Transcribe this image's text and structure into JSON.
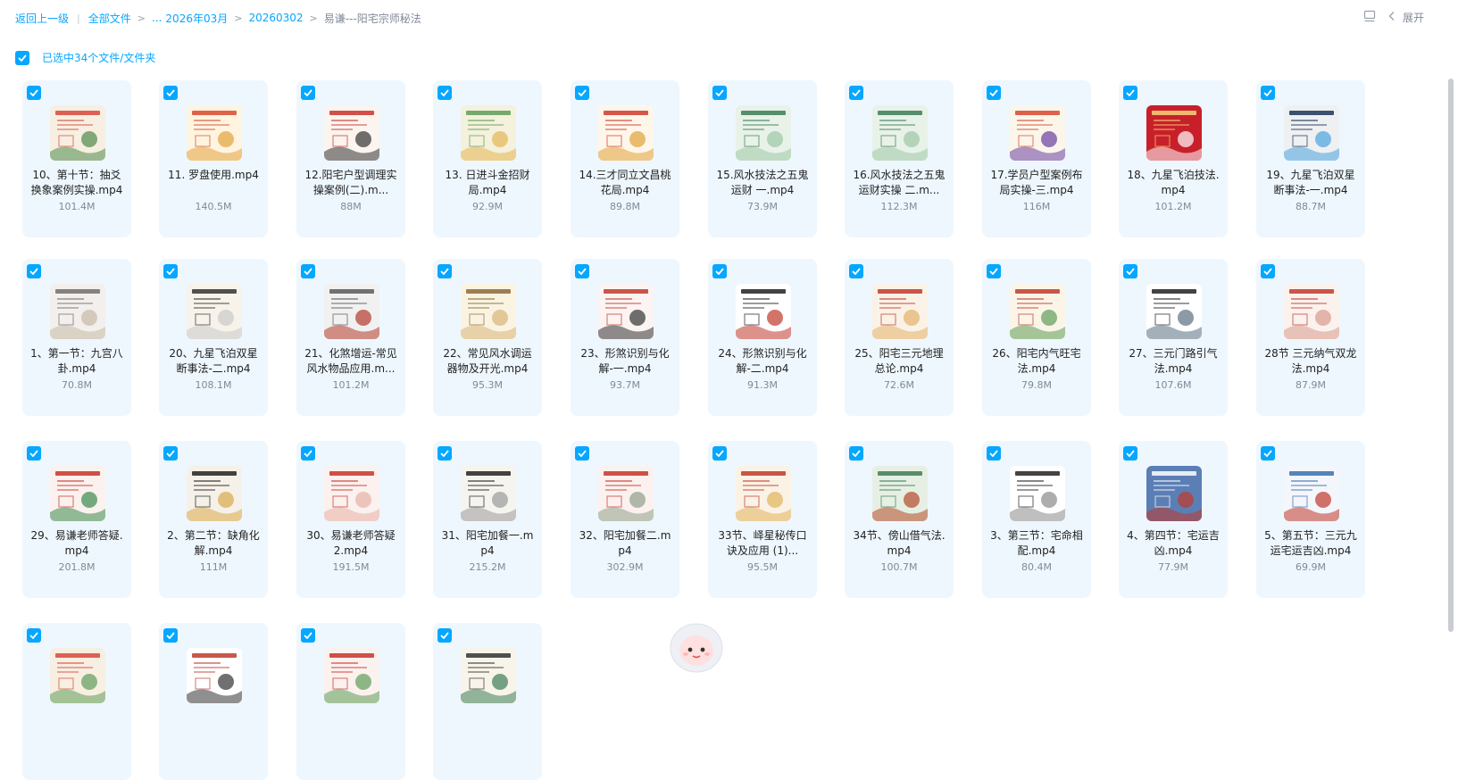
{
  "breadcrumb": {
    "back": "返回上一级",
    "all_files": "全部文件",
    "ellipsis": "...",
    "items": [
      "2026年03月",
      "20260302"
    ],
    "current": "易谦---阳宅宗师秘法"
  },
  "toolbar": {
    "expand_label": "展开"
  },
  "selection": {
    "label": "已选中34个文件/文件夹",
    "checked": true
  },
  "colors": {
    "accent": "#06a7ff",
    "card_bg": "#eef7fe",
    "muted": "#818999"
  },
  "files": [
    {
      "name": "10、第十节：抽爻换象案例实操.mp4",
      "size": "101.4M",
      "thumb": [
        "#f7efe2",
        "#d8483a",
        "#4f8a4a"
      ]
    },
    {
      "name": "11. 罗盘使用.mp4",
      "size": "140.5M",
      "thumb": [
        "#fff4e0",
        "#d84a2e",
        "#e2a23c"
      ]
    },
    {
      "name": "12.阳宅户型调理实操案例(二).m...",
      "size": "88M",
      "thumb": [
        "#fbf4ef",
        "#c8322b",
        "#333333"
      ]
    },
    {
      "name": "13. 日进斗金招财局.mp4",
      "size": "92.9M",
      "thumb": [
        "#f4f1dc",
        "#5f9d58",
        "#e4b552"
      ]
    },
    {
      "name": "14.三才同立文昌桃花局.mp4",
      "size": "89.8M",
      "thumb": [
        "#fff6ea",
        "#cf3a2a",
        "#e0a236"
      ]
    },
    {
      "name": "15.风水技法之五鬼运财 一.mp4",
      "size": "73.9M",
      "thumb": [
        "#e8f2e8",
        "#3d7d55",
        "#9cc8a5"
      ]
    },
    {
      "name": "16.风水技法之五鬼运财实操 二.m...",
      "size": "112.3M",
      "thumb": [
        "#e8f2e8",
        "#3d7d55",
        "#9cc8a5"
      ]
    },
    {
      "name": "17.学员户型案例布局实操-三.mp4",
      "size": "116M",
      "thumb": [
        "#fbf6ea",
        "#d9462e",
        "#6a3fa0"
      ]
    },
    {
      "name": "18、九星飞泊技法.mp4",
      "size": "101.2M",
      "thumb": [
        "#c8202a",
        "#f6d37a",
        "#ffffff"
      ]
    },
    {
      "name": "19、九星飞泊双星断事法-一.mp4",
      "size": "88.7M",
      "thumb": [
        "#eef0f2",
        "#1d3557",
        "#4aa3df"
      ]
    },
    {
      "name": "1、第一节：九宫八卦.mp4",
      "size": "70.8M",
      "thumb": [
        "#f3efec",
        "#6f6f6f",
        "#c7b9a8"
      ]
    },
    {
      "name": "20、九星飞泊双星断事法-二.mp4",
      "size": "108.1M",
      "thumb": [
        "#f7f3ea",
        "#333333",
        "#c9c9c9"
      ]
    },
    {
      "name": "21、化煞增运-常见风水物品应用.m...",
      "size": "101.2M",
      "thumb": [
        "#f1f1f1",
        "#5b5b5b",
        "#b43b2a"
      ]
    },
    {
      "name": "22、常见风水调运器物及开光.mp4",
      "size": "95.3M",
      "thumb": [
        "#fbf3e2",
        "#8a6a3a",
        "#d7b47a"
      ]
    },
    {
      "name": "23、形煞识别与化解-一.mp4",
      "size": "93.7M",
      "thumb": [
        "#fbf4f2",
        "#c0392b",
        "#333333"
      ]
    },
    {
      "name": "24、形煞识别与化解-二.mp4",
      "size": "91.3M",
      "thumb": [
        "#ffffff",
        "#222222",
        "#c0392b"
      ]
    },
    {
      "name": "25、阳宅三元地理总论.mp4",
      "size": "72.6M",
      "thumb": [
        "#faf2e6",
        "#c0392b",
        "#e3b26a"
      ]
    },
    {
      "name": "26、阳宅内气旺宅法.mp4",
      "size": "79.8M",
      "thumb": [
        "#fbf5e8",
        "#c0392b",
        "#5f9d58"
      ]
    },
    {
      "name": "27、三元门路引气法.mp4",
      "size": "107.6M",
      "thumb": [
        "#ffffff",
        "#222222",
        "#5a6f80"
      ]
    },
    {
      "name": "28节 三元纳气双龙法.mp4",
      "size": "87.9M",
      "thumb": [
        "#fbf2ee",
        "#c0392b",
        "#d99a8d"
      ]
    },
    {
      "name": "29、易谦老师答疑.mp4",
      "size": "201.8M",
      "thumb": [
        "#fbf1ee",
        "#c8322b",
        "#3b8a4e"
      ]
    },
    {
      "name": "2、第二节：缺角化解.mp4",
      "size": "111M",
      "thumb": [
        "#f6f1e8",
        "#222222",
        "#d8a94b"
      ]
    },
    {
      "name": "30、易谦老师答疑2.mp4",
      "size": "191.5M",
      "thumb": [
        "#fbf1ee",
        "#c8322b",
        "#e7b0a5"
      ]
    },
    {
      "name": "31、阳宅加餐一.mp4",
      "size": "215.2M",
      "thumb": [
        "#f6f4ef",
        "#222222",
        "#9a9a9a"
      ]
    },
    {
      "name": "32、阳宅加餐二.mp4",
      "size": "302.9M",
      "thumb": [
        "#fbf1ee",
        "#c8322b",
        "#8fa08a"
      ]
    },
    {
      "name": "33节、峄星秘传口诀及应用 (1)...",
      "size": "95.5M",
      "thumb": [
        "#fbf2e6",
        "#c0392b",
        "#e0b35a"
      ]
    },
    {
      "name": "34节、傍山借气法.mp4",
      "size": "100.7M",
      "thumb": [
        "#e6efe3",
        "#3d7d55",
        "#b34a2a"
      ]
    },
    {
      "name": "3、第三节：宅命相配.mp4",
      "size": "80.4M",
      "thumb": [
        "#ffffff",
        "#222222",
        "#8a8a8a"
      ]
    },
    {
      "name": "4、第四节：宅运吉凶.mp4",
      "size": "77.9M",
      "thumb": [
        "#5b7fb5",
        "#ffffff",
        "#c0392b"
      ]
    },
    {
      "name": "5、第五节：三元九运宅运吉凶.mp4",
      "size": "69.9M",
      "thumb": [
        "#f3f6fa",
        "#3a6fb0",
        "#c0392b"
      ]
    },
    {
      "name": "",
      "size": "",
      "thumb": [
        "#f7efe2",
        "#d8483a",
        "#5f9d58"
      ]
    },
    {
      "name": "",
      "size": "",
      "thumb": [
        "#ffffff",
        "#c0392b",
        "#333333"
      ]
    },
    {
      "name": "",
      "size": "",
      "thumb": [
        "#fbf1ee",
        "#c8322b",
        "#5f9d58"
      ]
    },
    {
      "name": "",
      "size": "",
      "thumb": [
        "#f8f4ea",
        "#333333",
        "#3d7d55"
      ]
    }
  ]
}
